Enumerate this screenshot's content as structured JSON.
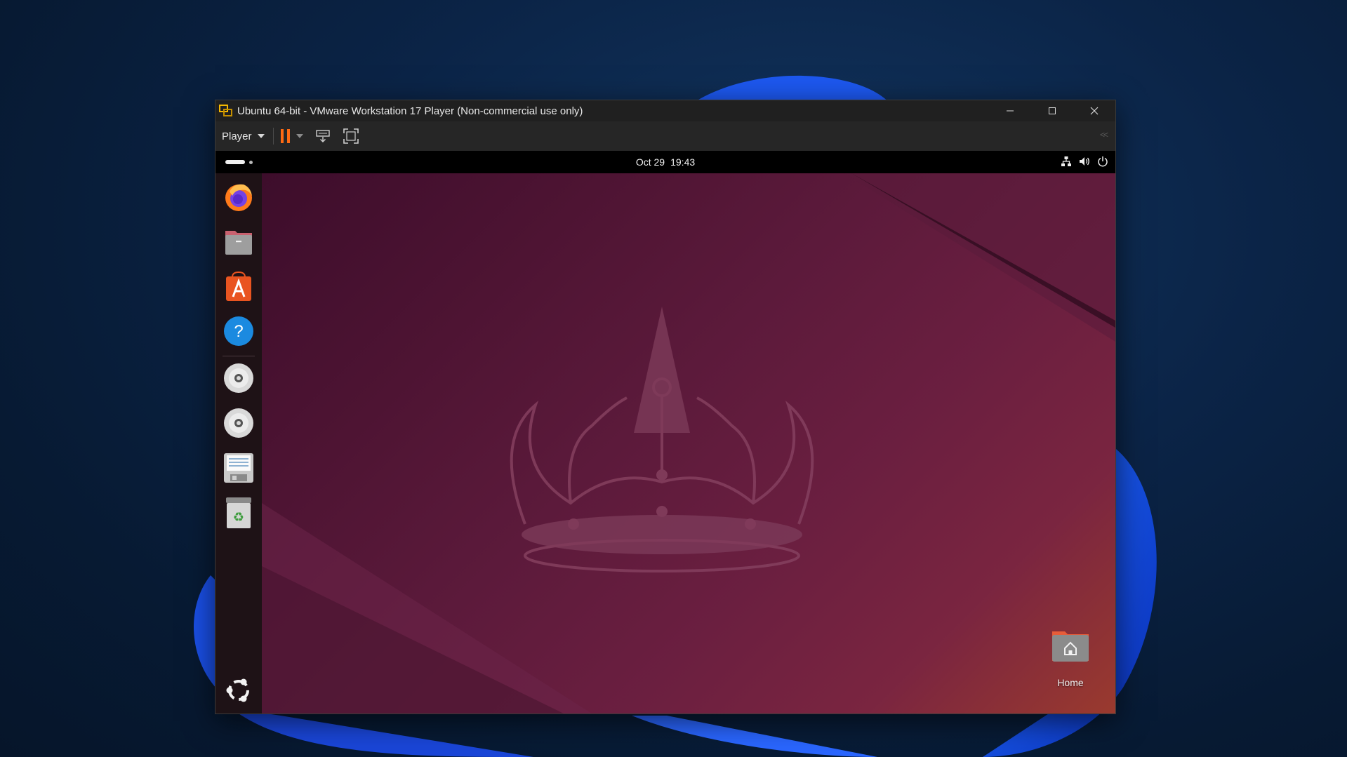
{
  "window": {
    "title": "Ubuntu 64-bit - VMware Workstation 17 Player (Non-commercial use only)",
    "controls": [
      "minimize-icon",
      "maximize-icon",
      "close-icon"
    ]
  },
  "toolbar": {
    "player_label": "Player",
    "buttons": [
      "pause-icon",
      "send-ctrl-alt-del-icon",
      "fullscreen-icon"
    ]
  },
  "ubuntu": {
    "top_bar": {
      "date": "Oct 29",
      "time": "19:43",
      "tray_icons": [
        "network-icon",
        "volume-icon",
        "power-icon"
      ]
    },
    "dock": {
      "items": [
        {
          "name": "Firefox",
          "icon": "firefox-icon"
        },
        {
          "name": "Files",
          "icon": "files-icon"
        },
        {
          "name": "App Center",
          "icon": "app-center-icon"
        },
        {
          "name": "Help",
          "icon": "help-icon"
        },
        {
          "name": "Optical Disc 1",
          "icon": "optical-disc-icon"
        },
        {
          "name": "Optical Disc 2",
          "icon": "optical-disc-icon"
        },
        {
          "name": "Floppy Disk",
          "icon": "floppy-disk-icon"
        },
        {
          "name": "Trash",
          "icon": "trash-icon"
        }
      ],
      "show_apps_icon": "ubuntu-logo-icon"
    },
    "desktop": {
      "home_label": "Home"
    }
  },
  "colors": {
    "accent": "#ff6a13",
    "titlebar": "#202020",
    "toolbar": "#262626",
    "dock": "#1e1216",
    "wallpaper_start": "#3d0d2b",
    "wallpaper_end": "#9a3a2e"
  }
}
